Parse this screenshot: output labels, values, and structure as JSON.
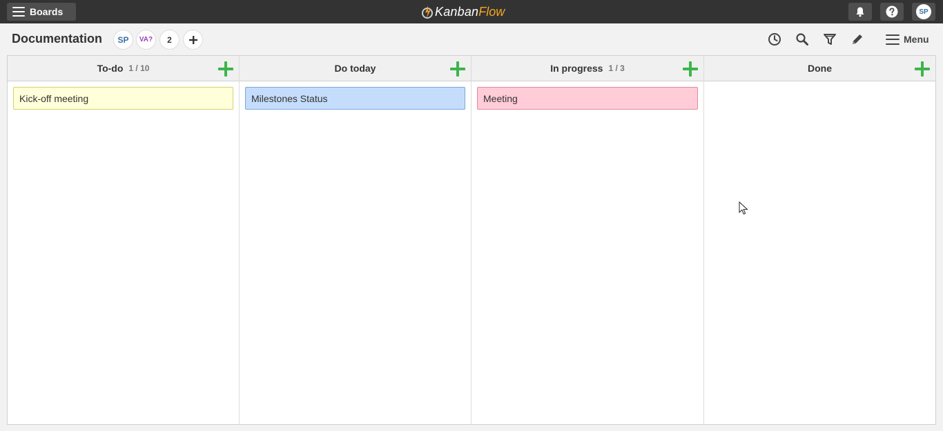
{
  "topbar": {
    "boards_label": "Boards",
    "logo_part1": "Kanban",
    "logo_part2": "Flow",
    "user_initials": "SP"
  },
  "board": {
    "title": "Documentation",
    "members": [
      {
        "initials": "SP",
        "color": "#3a6ea5"
      },
      {
        "initials": "VA?",
        "color": "#9b3fb0"
      },
      {
        "initials": "2",
        "color": "#333333"
      }
    ],
    "menu_label": "Menu"
  },
  "columns": [
    {
      "name": "To-do",
      "wip": "1 / 10",
      "cards": [
        {
          "title": "Kick-off meeting",
          "color": "#ffffd9",
          "border": "#d8cf6e"
        }
      ]
    },
    {
      "name": "Do today",
      "wip": "",
      "cards": [
        {
          "title": "Milestones Status",
          "color": "#c5ddfc",
          "border": "#7aa6db"
        }
      ]
    },
    {
      "name": "In progress",
      "wip": "1 / 3",
      "cards": [
        {
          "title": "Meeting",
          "color": "#ffccd8",
          "border": "#e08a9e"
        }
      ]
    },
    {
      "name": "Done",
      "wip": "",
      "cards": []
    }
  ],
  "colors": {
    "topbar_bg": "#333333",
    "add_green": "#3cb54a",
    "logo_accent": "#f5a623"
  }
}
